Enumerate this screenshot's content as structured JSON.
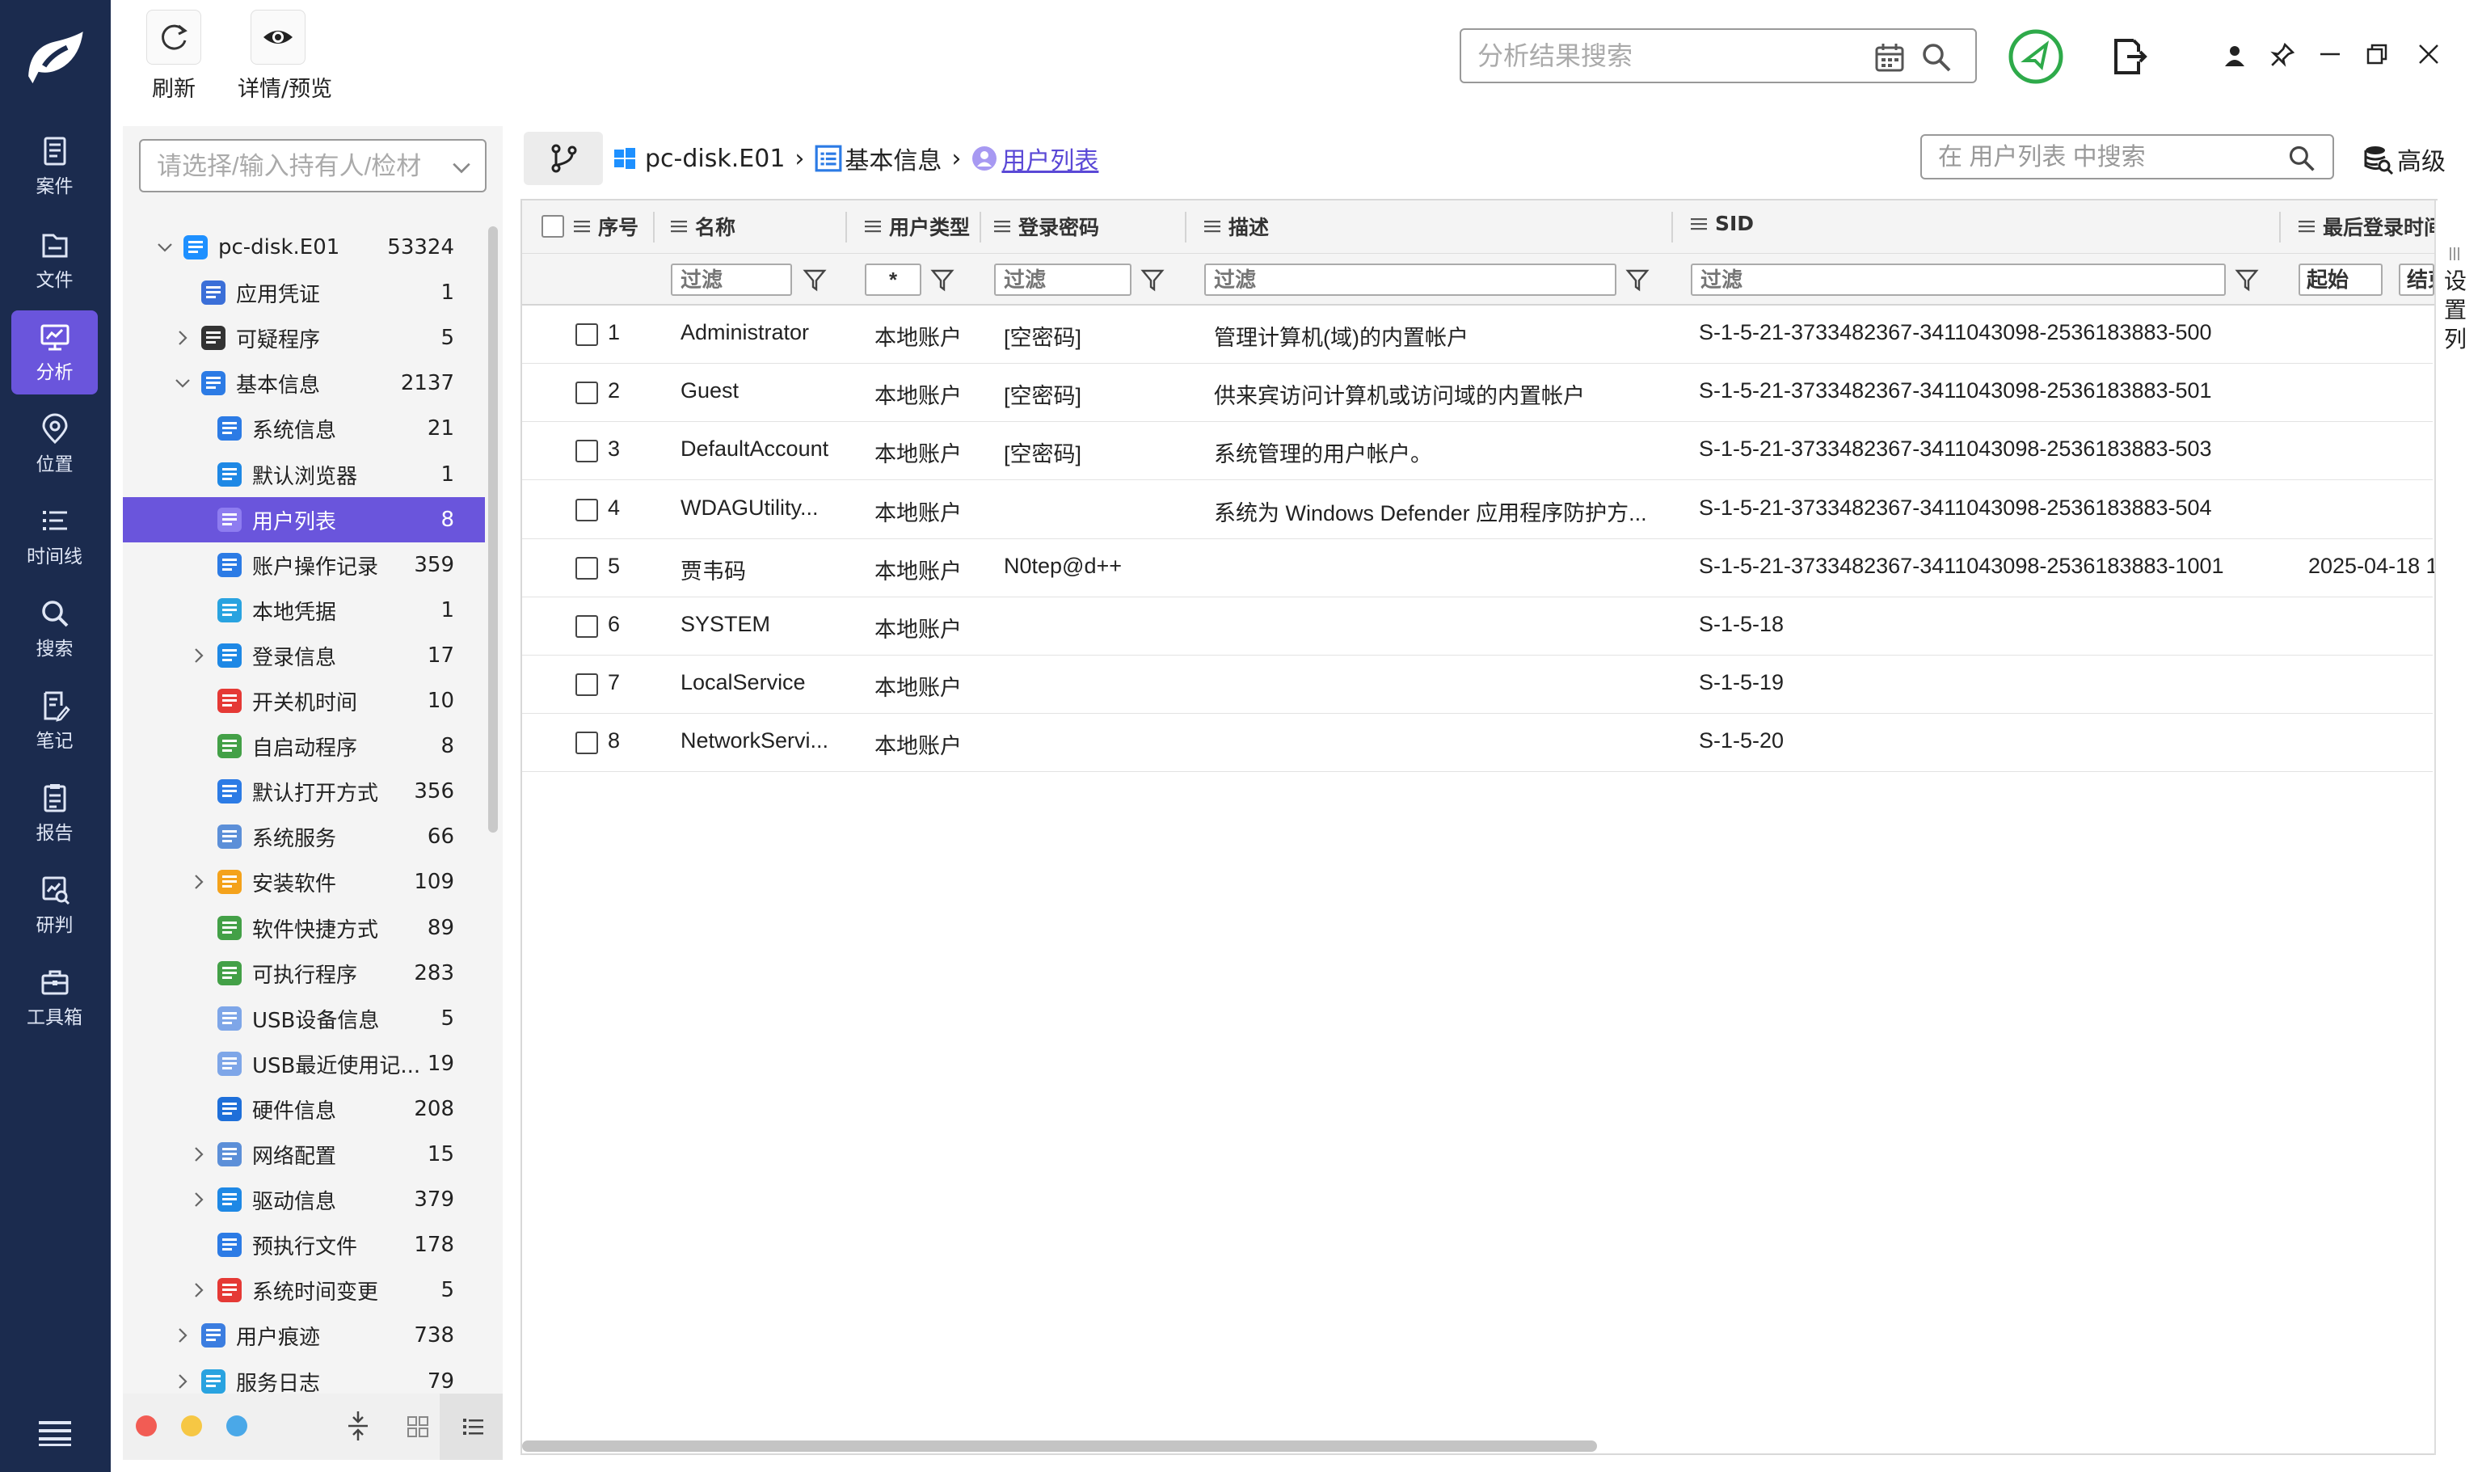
{
  "nav": {
    "items": [
      {
        "label": "案件",
        "icon": "case-icon"
      },
      {
        "label": "文件",
        "icon": "folder-icon"
      },
      {
        "label": "分析",
        "icon": "analysis-icon",
        "active": true
      },
      {
        "label": "位置",
        "icon": "location-icon"
      },
      {
        "label": "时间线",
        "icon": "timeline-icon"
      },
      {
        "label": "搜索",
        "icon": "search-icon"
      },
      {
        "label": "笔记",
        "icon": "note-icon"
      },
      {
        "label": "报告",
        "icon": "report-icon"
      },
      {
        "label": "研判",
        "icon": "judge-icon"
      },
      {
        "label": "工具箱",
        "icon": "toolbox-icon"
      }
    ]
  },
  "toolbar": {
    "refresh_label": "刷新",
    "preview_label": "详情/预览",
    "search_placeholder": "分析结果搜索"
  },
  "tree": {
    "search_placeholder": "请选择/输入持有人/检材",
    "items": [
      {
        "label": "pc-disk.E01",
        "count": "53324",
        "level": 0,
        "expand": "open",
        "icon": "windows-icon",
        "color": "#1e90ff"
      },
      {
        "label": "应用凭证",
        "count": "1",
        "level": 1,
        "expand": "none",
        "icon": "credential-icon",
        "color": "#3b6fd8"
      },
      {
        "label": "可疑程序",
        "count": "5",
        "level": 1,
        "expand": "closed",
        "icon": "suspicious-icon",
        "color": "#333333"
      },
      {
        "label": "基本信息",
        "count": "2137",
        "level": 1,
        "expand": "open",
        "icon": "basic-info-icon",
        "color": "#2c7be5"
      },
      {
        "label": "系统信息",
        "count": "21",
        "level": 2,
        "expand": "none",
        "icon": "system-info-icon",
        "color": "#2c7be5"
      },
      {
        "label": "默认浏览器",
        "count": "1",
        "level": 2,
        "expand": "none",
        "icon": "browser-icon",
        "color": "#1e88e5"
      },
      {
        "label": "用户列表",
        "count": "8",
        "level": 2,
        "expand": "none",
        "icon": "user-list-icon",
        "color": "#8e7cf0",
        "selected": true
      },
      {
        "label": "账户操作记录",
        "count": "359",
        "level": 2,
        "expand": "none",
        "icon": "account-log-icon",
        "color": "#2c7be5"
      },
      {
        "label": "本地凭据",
        "count": "1",
        "level": 2,
        "expand": "none",
        "icon": "local-credential-icon",
        "color": "#29a3e0"
      },
      {
        "label": "登录信息",
        "count": "17",
        "level": 2,
        "expand": "closed",
        "icon": "login-icon",
        "color": "#1e88e5"
      },
      {
        "label": "开关机时间",
        "count": "10",
        "level": 2,
        "expand": "none",
        "icon": "power-icon",
        "color": "#e53935"
      },
      {
        "label": "自启动程序",
        "count": "8",
        "level": 2,
        "expand": "none",
        "icon": "autostart-icon",
        "color": "#43a047"
      },
      {
        "label": "默认打开方式",
        "count": "356",
        "level": 2,
        "expand": "none",
        "icon": "default-open-icon",
        "color": "#2c7be5"
      },
      {
        "label": "系统服务",
        "count": "66",
        "level": 2,
        "expand": "none",
        "icon": "service-icon",
        "color": "#5c8fd8"
      },
      {
        "label": "安装软件",
        "count": "109",
        "level": 2,
        "expand": "closed",
        "icon": "package-icon",
        "color": "#f4a21b"
      },
      {
        "label": "软件快捷方式",
        "count": "89",
        "level": 2,
        "expand": "none",
        "icon": "shortcut-icon",
        "color": "#43a047"
      },
      {
        "label": "可执行程序",
        "count": "283",
        "level": 2,
        "expand": "none",
        "icon": "executable-icon",
        "color": "#43a047"
      },
      {
        "label": "USB设备信息",
        "count": "5",
        "level": 2,
        "expand": "none",
        "icon": "usb-icon",
        "color": "#7ea6e8"
      },
      {
        "label": "USB最近使用记...",
        "count": "19",
        "level": 2,
        "expand": "none",
        "icon": "usb-recent-icon",
        "color": "#7ea6e8"
      },
      {
        "label": "硬件信息",
        "count": "208",
        "level": 2,
        "expand": "none",
        "icon": "hardware-icon",
        "color": "#1e6fd9"
      },
      {
        "label": "网络配置",
        "count": "15",
        "level": 2,
        "expand": "closed",
        "icon": "network-icon",
        "color": "#5c8fd8"
      },
      {
        "label": "驱动信息",
        "count": "379",
        "level": 2,
        "expand": "closed",
        "icon": "driver-icon",
        "color": "#1e88e5"
      },
      {
        "label": "预执行文件",
        "count": "178",
        "level": 2,
        "expand": "none",
        "icon": "prefetch-icon",
        "color": "#2c7be5"
      },
      {
        "label": "系统时间变更",
        "count": "5",
        "level": 2,
        "expand": "closed",
        "icon": "clock-icon",
        "color": "#e53935"
      },
      {
        "label": "用户痕迹",
        "count": "738",
        "level": 1,
        "expand": "closed",
        "icon": "trace-icon",
        "color": "#3b7de0"
      },
      {
        "label": "服务日志",
        "count": "79",
        "level": 1,
        "expand": "closed",
        "icon": "log-icon",
        "color": "#29a3e0"
      }
    ]
  },
  "breadcrumb": {
    "root": "pc-disk.E01",
    "mid": "基本信息",
    "current": "用户列表",
    "sep": "›",
    "search_placeholder": "在 用户列表 中搜索",
    "advanced_label": "高级"
  },
  "grid": {
    "columns": [
      "序号",
      "名称",
      "用户类型",
      "登录密码",
      "描述",
      "SID",
      "最后登录时间"
    ],
    "filter_placeholder": "过滤",
    "type_filter_value": "*",
    "date_start": "起始",
    "date_end": "结束",
    "settings_label": "设置列",
    "rows": [
      {
        "no": "1",
        "name": "Administrator",
        "type": "本地账户",
        "password": "[空密码]",
        "desc": "管理计算机(域)的内置帐户",
        "sid": "S-1-5-21-3733482367-3411043098-2536183883-500",
        "last": ""
      },
      {
        "no": "2",
        "name": "Guest",
        "type": "本地账户",
        "password": "[空密码]",
        "desc": "供来宾访问计算机或访问域的内置帐户",
        "sid": "S-1-5-21-3733482367-3411043098-2536183883-501",
        "last": ""
      },
      {
        "no": "3",
        "name": "DefaultAccount",
        "type": "本地账户",
        "password": "[空密码]",
        "desc": "系统管理的用户帐户。",
        "sid": "S-1-5-21-3733482367-3411043098-2536183883-503",
        "last": ""
      },
      {
        "no": "4",
        "name": "WDAGUtility...",
        "type": "本地账户",
        "password": "",
        "desc": "系统为 Windows Defender 应用程序防护方...",
        "sid": "S-1-5-21-3733482367-3411043098-2536183883-504",
        "last": ""
      },
      {
        "no": "5",
        "name": "贾韦码",
        "type": "本地账户",
        "password": "N0tep@d++",
        "desc": "",
        "sid": "S-1-5-21-3733482367-3411043098-2536183883-1001",
        "last": "2025-04-18 1"
      },
      {
        "no": "6",
        "name": "SYSTEM",
        "type": "本地账户",
        "password": "",
        "desc": "",
        "sid": "S-1-5-18",
        "last": ""
      },
      {
        "no": "7",
        "name": "LocalService",
        "type": "本地账户",
        "password": "",
        "desc": "",
        "sid": "S-1-5-19",
        "last": ""
      },
      {
        "no": "8",
        "name": "NetworkServi...",
        "type": "本地账户",
        "password": "",
        "desc": "",
        "sid": "S-1-5-20",
        "last": ""
      }
    ]
  },
  "footer": {
    "dot_colors": [
      "#f25c54",
      "#f6c744",
      "#4aa8e8"
    ]
  }
}
